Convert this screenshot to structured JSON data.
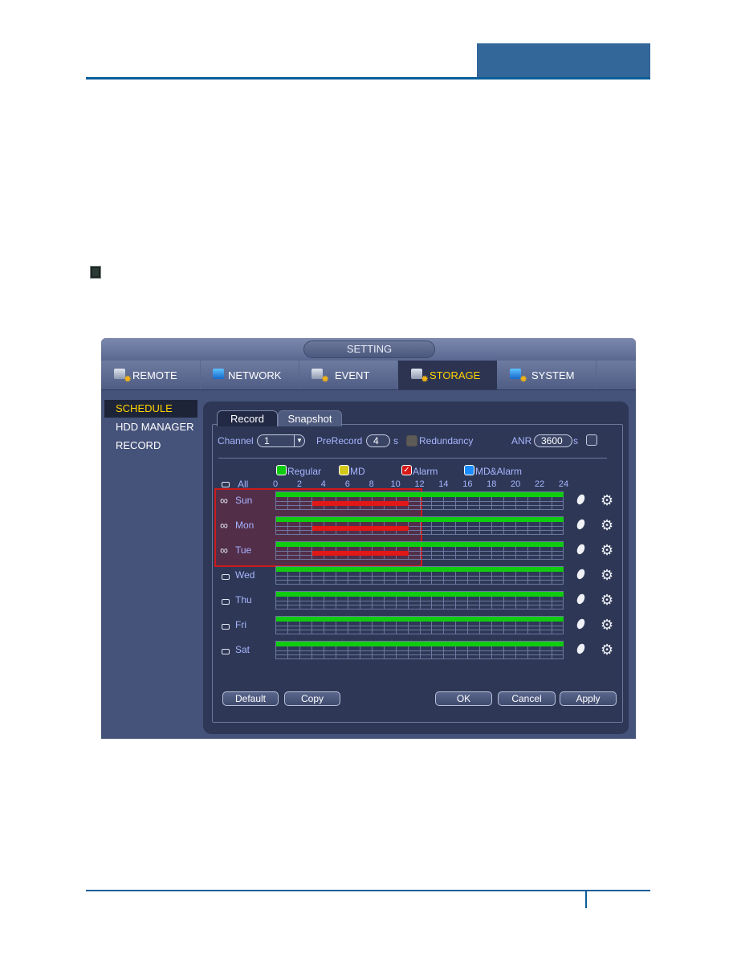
{
  "document": {
    "note_icon": "note-square-icon"
  },
  "window": {
    "title": "SETTING",
    "tabs": [
      {
        "label": "REMOTE",
        "icon": "remote-gear-icon",
        "active": false
      },
      {
        "label": "NETWORK",
        "icon": "network-icon",
        "active": false
      },
      {
        "label": "EVENT",
        "icon": "event-icon",
        "active": false
      },
      {
        "label": "STORAGE",
        "icon": "storage-icon",
        "active": true
      },
      {
        "label": "SYSTEM",
        "icon": "system-monitor-icon",
        "active": false
      }
    ],
    "sidebar": [
      {
        "label": "SCHEDULE",
        "active": true
      },
      {
        "label": "HDD MANAGER",
        "active": false
      },
      {
        "label": "RECORD",
        "active": false
      }
    ],
    "subtabs": [
      {
        "label": "Record",
        "active": true
      },
      {
        "label": "Snapshot",
        "active": false
      }
    ],
    "settings": {
      "channel_label": "Channel",
      "channel_value": "1",
      "prerecord_label": "PreRecord",
      "prerecord_value": "4",
      "prerecord_unit": "s",
      "redundancy_label": "Redundancy",
      "redundancy_checked": false,
      "redundancy_disabled": true,
      "anr_label": "ANR",
      "anr_value": "3600",
      "anr_unit": "s",
      "anr_checked": false
    },
    "legend": [
      {
        "label": "Regular",
        "color": "#10cc10",
        "checked": false
      },
      {
        "label": "MD",
        "color": "#d4c81a",
        "checked": false
      },
      {
        "label": "Alarm",
        "color": "#d81818",
        "checked": true
      },
      {
        "label": "MD&Alarm",
        "color": "#1a8cff",
        "checked": false
      }
    ],
    "all_label": "All",
    "hours": [
      "0",
      "2",
      "4",
      "6",
      "8",
      "10",
      "12",
      "14",
      "16",
      "18",
      "20",
      "22",
      "24"
    ],
    "days": [
      {
        "label": "Sun",
        "linked": true,
        "regular": [
          0,
          24
        ],
        "alarm": [
          3,
          11
        ]
      },
      {
        "label": "Mon",
        "linked": true,
        "regular": [
          0,
          24
        ],
        "alarm": [
          3,
          11
        ]
      },
      {
        "label": "Tue",
        "linked": true,
        "regular": [
          0,
          24
        ],
        "alarm": [
          3,
          11
        ]
      },
      {
        "label": "Wed",
        "linked": false,
        "regular": [
          0,
          24
        ],
        "alarm": null
      },
      {
        "label": "Thu",
        "linked": false,
        "regular": [
          0,
          24
        ],
        "alarm": null
      },
      {
        "label": "Fri",
        "linked": false,
        "regular": [
          0,
          24
        ],
        "alarm": null
      },
      {
        "label": "Sat",
        "linked": false,
        "regular": [
          0,
          24
        ],
        "alarm": null
      }
    ],
    "row_icons": [
      "eraser-icon",
      "gear-icon"
    ],
    "buttons": {
      "default": "Default",
      "copy": "Copy",
      "ok": "OK",
      "cancel": "Cancel",
      "apply": "Apply"
    }
  }
}
